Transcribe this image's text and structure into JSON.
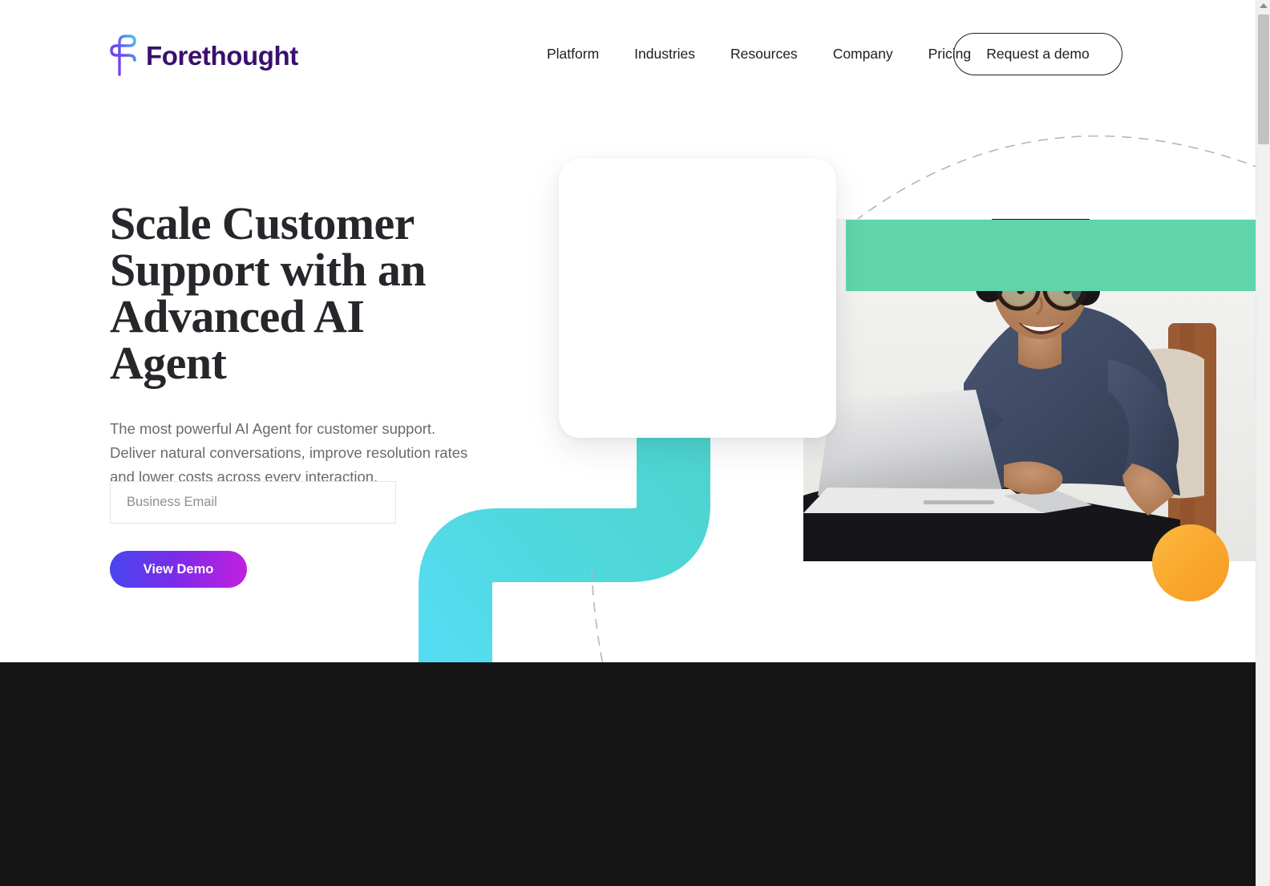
{
  "brand": {
    "name": "Forethought",
    "mark_icon": "forethought-f-logo-icon",
    "mark_gradient_start": "#7B3BE8",
    "mark_gradient_end": "#3FC8F0",
    "wordmark_color": "#3A1070"
  },
  "nav": {
    "items": [
      {
        "label": "Platform"
      },
      {
        "label": "Industries"
      },
      {
        "label": "Resources"
      },
      {
        "label": "Company"
      },
      {
        "label": "Pricing"
      }
    ],
    "cta": {
      "label": "Request a demo"
    }
  },
  "hero": {
    "title": "Scale Customer Support with an Advanced AI Agent",
    "subtitle": "The most powerful AI Agent for customer support. Deliver natural conversations, improve resolution rates and lower costs across every interaction.",
    "form": {
      "email_value": "",
      "email_placeholder": "Business Email",
      "submit_label": "View Demo",
      "submit_gradient_start": "#4646F0",
      "submit_gradient_end": "#C41FE0"
    },
    "graphics": {
      "card_icon": "empty-white-card",
      "ribbon_icon": "teal-s-curve-ribbon",
      "ribbon_color_start": "#4FD6D2",
      "ribbon_color_end": "#52D9E8",
      "arc_icon": "dashed-arc",
      "drop_line_icon": "dashed-vertical-line",
      "green_band_color": "#60D5AB",
      "orange_circle_icon": "orange-circle",
      "orange_circle_color": "#F9A72C",
      "photo_icon": "smiling-woman-with-laptop-photo",
      "photo_alt": "Smiling woman with glasses working on a laptop"
    }
  },
  "below_fold": {
    "background_color": "#151515"
  },
  "scrollbar": {
    "up_arrow_icon": "scroll-up-arrow-icon",
    "thumb_icon": "scrollbar-thumb"
  }
}
